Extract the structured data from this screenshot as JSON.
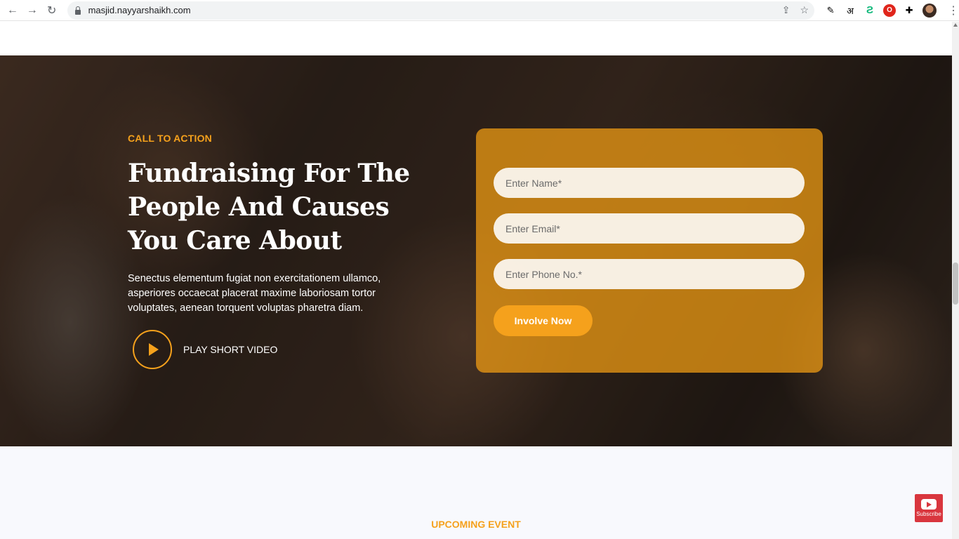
{
  "browser": {
    "url": "masjid.nayyarshaikh.com",
    "nav": {
      "back_icon": "back-arrow-icon",
      "forward_icon": "forward-arrow-icon",
      "reload_icon": "reload-icon"
    },
    "extensions": {
      "hindi_glyph": "अ",
      "opera_glyph": "O"
    }
  },
  "hero": {
    "eyebrow": "CALL TO ACTION",
    "headline": "Fundraising For The People And Causes You Care About",
    "description": "Senectus elementum fugiat non exercitationem ullamco, asperiores occaecat placerat maxime laboriosam tortor voluptates, aenean torquent voluptas pharetra diam.",
    "video_label": "PLAY SHORT VIDEO"
  },
  "form": {
    "name_placeholder": "Enter Name*",
    "email_placeholder": "Enter Email*",
    "phone_placeholder": "Enter Phone No.*",
    "submit_label": "Involve Now"
  },
  "section": {
    "upcoming_label": "UPCOMING EVENT"
  },
  "overlay": {
    "subscribe_label": "Subscribe"
  },
  "colors": {
    "accent": "#f5a11c",
    "subscribe_red": "#d9363e"
  }
}
